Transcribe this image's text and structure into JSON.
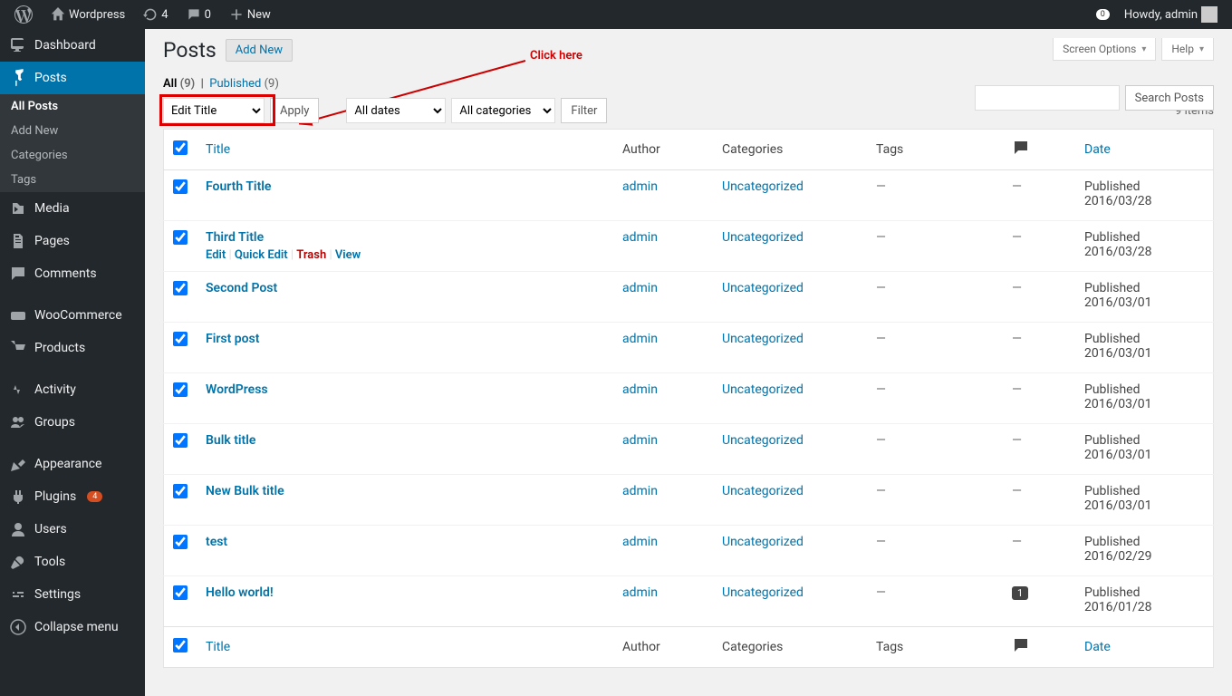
{
  "topbar": {
    "site_name": "Wordpress",
    "updates": "4",
    "comments": "0",
    "new_label": "New",
    "greeting": "Howdy, admin",
    "notif": "0"
  },
  "sidebar": {
    "dashboard": "Dashboard",
    "posts": "Posts",
    "submenu": {
      "all_posts": "All Posts",
      "add_new": "Add New",
      "categories": "Categories",
      "tags": "Tags"
    },
    "media": "Media",
    "pages": "Pages",
    "comments": "Comments",
    "woocommerce": "WooCommerce",
    "products": "Products",
    "activity": "Activity",
    "groups": "Groups",
    "appearance": "Appearance",
    "plugins": "Plugins",
    "plugins_count": "4",
    "users": "Users",
    "tools": "Tools",
    "settings": "Settings",
    "collapse": "Collapse menu"
  },
  "page": {
    "title": "Posts",
    "add_new": "Add New",
    "screen_options": "Screen Options",
    "help": "Help"
  },
  "filters": {
    "all_label": "All",
    "all_count": "(9)",
    "published_label": "Published",
    "published_count": "(9)",
    "bulk_action": "Edit Title",
    "apply": "Apply",
    "dates": "All dates",
    "categories": "All categories",
    "filter": "Filter",
    "item_count": "9 items",
    "search_btn": "Search Posts"
  },
  "columns": {
    "title": "Title",
    "author": "Author",
    "categories": "Categories",
    "tags": "Tags",
    "date": "Date"
  },
  "row_actions": {
    "edit": "Edit",
    "quick_edit": "Quick Edit",
    "trash": "Trash",
    "view": "View"
  },
  "status": {
    "published": "Published"
  },
  "posts": [
    {
      "title": "Fourth Title",
      "author": "admin",
      "category": "Uncategorized",
      "tags": "—",
      "comments": "—",
      "date": "2016/03/28",
      "hover": false
    },
    {
      "title": "Third Title",
      "author": "admin",
      "category": "Uncategorized",
      "tags": "—",
      "comments": "—",
      "date": "2016/03/28",
      "hover": true
    },
    {
      "title": "Second Post",
      "author": "admin",
      "category": "Uncategorized",
      "tags": "—",
      "comments": "—",
      "date": "2016/03/01",
      "hover": false
    },
    {
      "title": "First post",
      "author": "admin",
      "category": "Uncategorized",
      "tags": "—",
      "comments": "—",
      "date": "2016/03/01",
      "hover": false
    },
    {
      "title": "WordPress",
      "author": "admin",
      "category": "Uncategorized",
      "tags": "—",
      "comments": "—",
      "date": "2016/03/01",
      "hover": false
    },
    {
      "title": "Bulk title",
      "author": "admin",
      "category": "Uncategorized",
      "tags": "—",
      "comments": "—",
      "date": "2016/03/01",
      "hover": false
    },
    {
      "title": "New Bulk title",
      "author": "admin",
      "category": "Uncategorized",
      "tags": "—",
      "comments": "—",
      "date": "2016/03/01",
      "hover": false
    },
    {
      "title": "test",
      "author": "admin",
      "category": "Uncategorized",
      "tags": "—",
      "comments": "—",
      "date": "2016/02/29",
      "hover": false
    },
    {
      "title": "Hello world!",
      "author": "admin",
      "category": "Uncategorized",
      "tags": "—",
      "comments": "1",
      "date": "2016/01/28",
      "hover": false
    }
  ],
  "annotation": {
    "text": "Click here"
  }
}
